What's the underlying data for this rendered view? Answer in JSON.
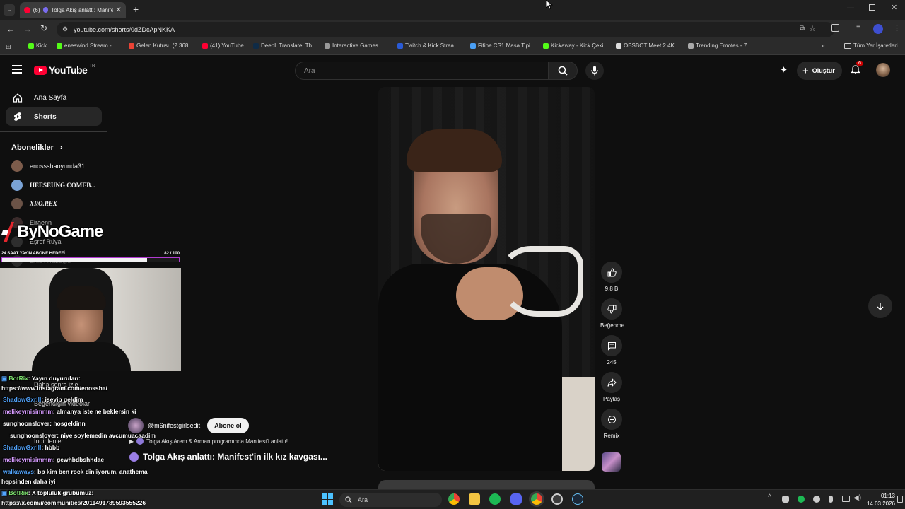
{
  "browser": {
    "tab_title": "Tolga Akış anlattı: Manife",
    "tab_count_badge": "(6)",
    "url": "youtube.com/shorts/0dZDcApNKKA",
    "bookmarks": [
      "Kick",
      "eneswind Stream -...",
      "Gelen Kutusu (2.368...",
      "(41) YouTube",
      "DeepL Translate: Th...",
      "Interactive Games...",
      "Twitch & Kick Strea...",
      "Fifine CS1 Masa Tipi...",
      "Kickaway - Kick Çeki...",
      "OBSBOT Meet 2 4K...",
      "Trending Emotes - 7..."
    ],
    "all_bookmarks": "Tüm Yer İşaretleri"
  },
  "youtube": {
    "logo": "YouTube",
    "logo_region": "TR",
    "search_placeholder": "Ara",
    "create_label": "Oluştur",
    "notif_count": "6",
    "nav": {
      "home": "Ana Sayfa",
      "shorts": "Shorts"
    },
    "subs_title": "Abonelikler",
    "subs": [
      "enossshaoyunda31",
      "HEESEUNG COMEB...",
      "XRO.REX",
      "Elraenn",
      "Eşref Rüya",
      "Enis Kırazoğlu"
    ],
    "hidden_menu": [
      "Daha sonra izle",
      "Beğendiğin videolar",
      "İndirilenler"
    ],
    "short": {
      "channel": "@m6nifestgirlsedit",
      "subscribe": "Abone ol",
      "audio": "Tolga Akış Arem & Arman programında Manifest'i anlattı! ...",
      "title": "Tolga Akış anlattı: Manifest'in ilk kız kavgası..."
    },
    "actions": {
      "likes": "9,8 B",
      "dislike": "Beğenme",
      "comments": "245",
      "share": "Paylaş",
      "remix": "Remix"
    }
  },
  "overlay": {
    "brand": "ByNoGame",
    "goal_label": "24 SAAT YAYIN ABONE HEDEFİ",
    "goal_current": "82",
    "goal_sep": "/",
    "goal_total": "100",
    "goal_fraction": 0.82,
    "chat": [
      {
        "user": "BotRix",
        "msg": ": Yayın duyuruları:"
      },
      {
        "user": "",
        "msg": "https://www.instagram.com/enossha/"
      },
      {
        "user": "ShadowGxrlll",
        "msg": ": iseyip geldim"
      },
      {
        "user": "melikeymisimmm",
        "msg": ": almanya iste ne beklersin ki"
      },
      {
        "user": "sunghoonslover",
        "msg": ": hosgeldinn"
      },
      {
        "user": "sunghoonslover",
        "msg": ": niye soylemedin avcumuacaadim"
      },
      {
        "user": "ShadowGxrlll",
        "msg": ": hbbb"
      },
      {
        "user": "melikeymisimmm",
        "msg": ": gewhbdbshhdae"
      },
      {
        "user": "walkaways",
        "msg": ": bp kim ben rock dinliyorum, anathema"
      },
      {
        "user": "",
        "msg": "hepsinden daha iyi"
      },
      {
        "user": "BotRix",
        "msg": ": X topluluk grubumuz:"
      },
      {
        "user": "",
        "msg": "https://x.com/i/communities/2011491789593555226"
      }
    ]
  },
  "taskbar": {
    "search": "Ara",
    "time": "01:13",
    "date": "14.03.2026"
  }
}
